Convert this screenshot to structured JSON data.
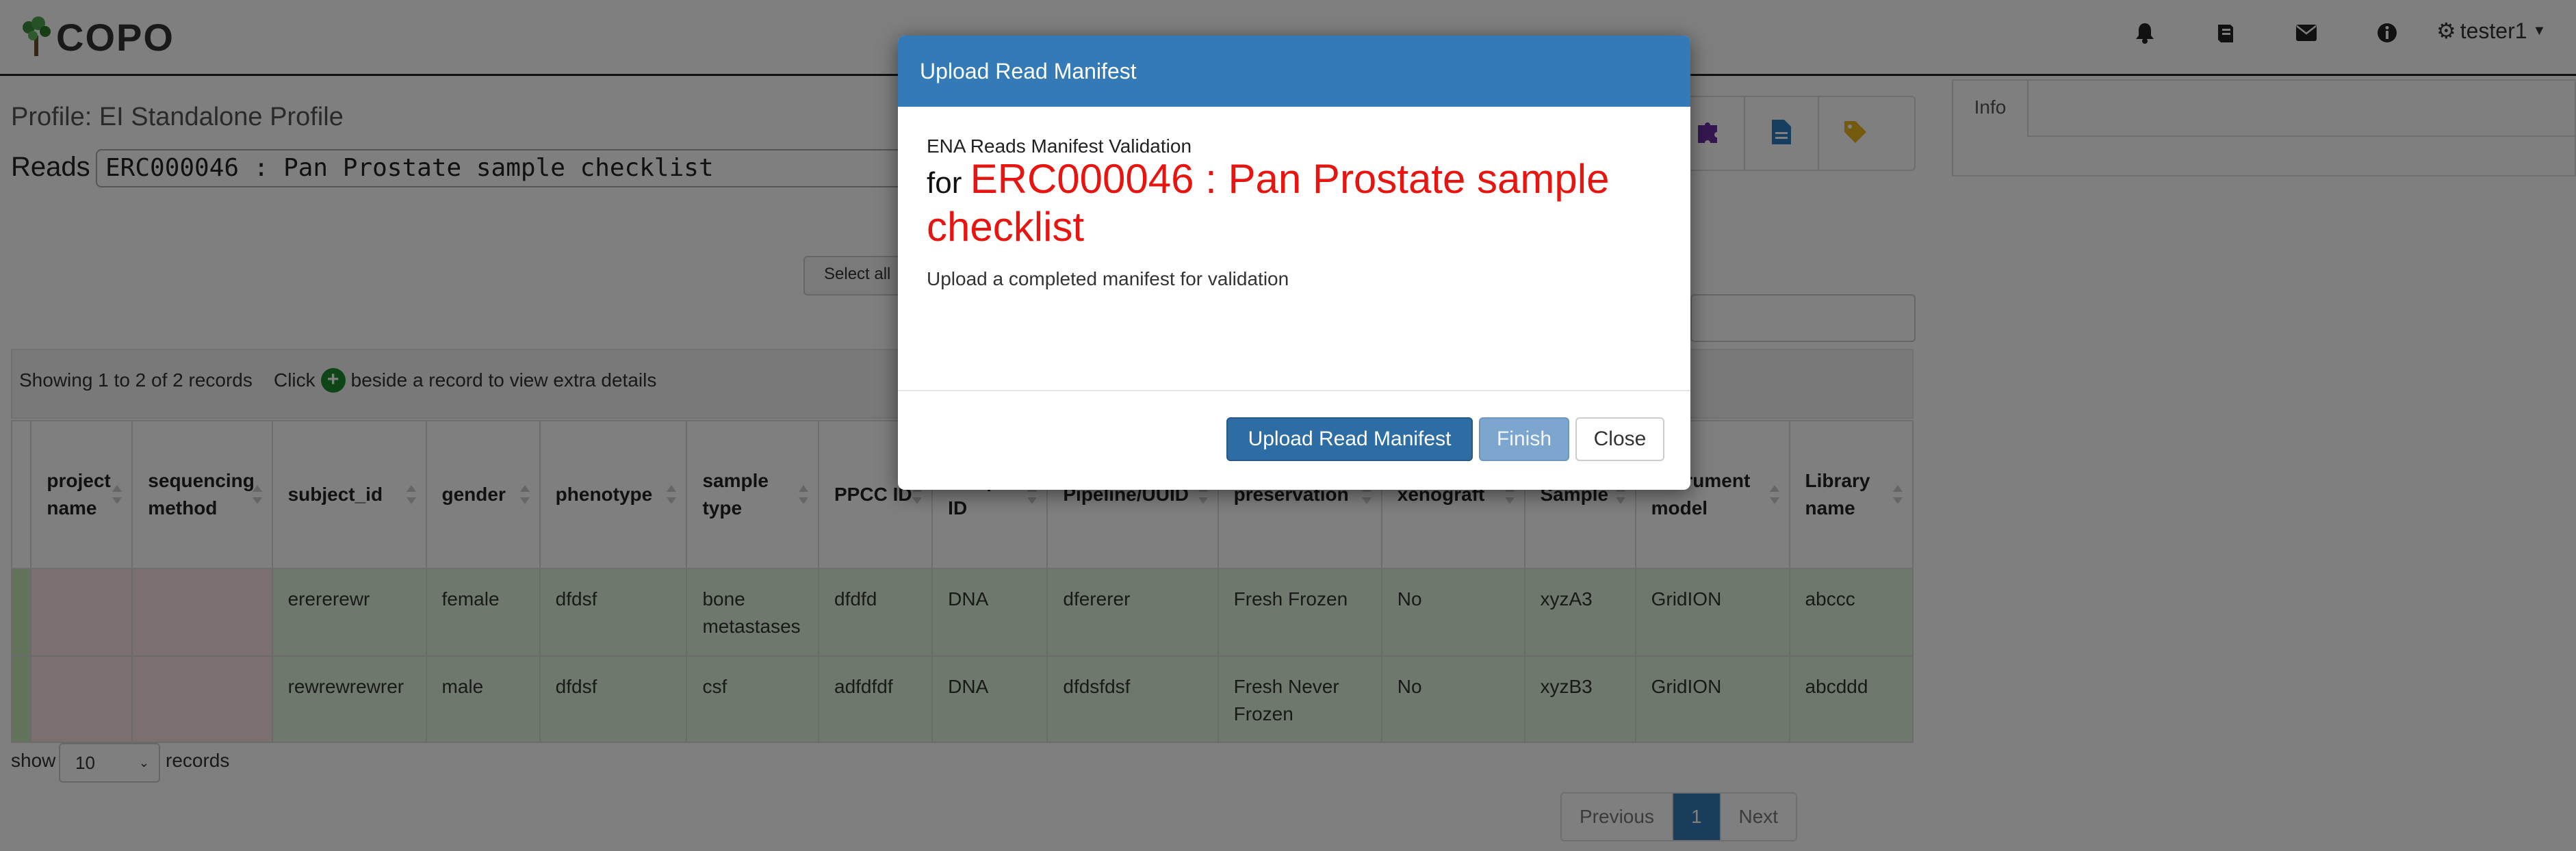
{
  "navbar": {
    "brand": "COPO",
    "icons": [
      "bell-icon",
      "book-icon",
      "envelope-icon",
      "info-icon"
    ],
    "user": "tester1"
  },
  "page": {
    "profile_title": "Profile: EI Standalone Profile",
    "reads_label": "Reads (",
    "checklist_selected": "ERC000046 : Pan Prostate sample checklist",
    "select_all": "Select all",
    "records_info_prefix": "Showing 1 to 2 of 2 records    Click",
    "records_info_suffix": "beside a record to view extra details",
    "show_label": "show",
    "page_size": "10",
    "records_label": "records",
    "info_tab": "Info"
  },
  "table": {
    "columns": [
      "project name",
      "sequencing method",
      "subject_id",
      "gender",
      "phenotype",
      "sample type",
      "PPCC ID",
      "sample ID",
      "Pipeline/UUID",
      "preservation",
      "xenograft",
      "Sample",
      "Instrument model",
      "Library name"
    ],
    "rows": [
      [
        "",
        "",
        "erererewr",
        "female",
        "dfdsf",
        "bone metastases",
        "dfdfd",
        "DNA",
        "dfererer",
        "Fresh Frozen",
        "No",
        "xyzA3",
        "GridION",
        "abccc"
      ],
      [
        "",
        "",
        "rewrewrewrer",
        "male",
        "dfdsf",
        "csf",
        "adfdfdf",
        "DNA",
        "dfdsfdsf",
        "Fresh Never Frozen",
        "No",
        "xyzB3",
        "GridION",
        "abcddd"
      ]
    ]
  },
  "pagination": {
    "previous": "Previous",
    "current": "1",
    "next": "Next"
  },
  "modal": {
    "title": "Upload Read Manifest",
    "validation_label": "ENA Reads Manifest Validation",
    "for_word": "for",
    "checklist_name": "ERC000046 : Pan Prostate sample checklist",
    "description": "Upload a completed manifest for validation",
    "buttons": {
      "upload": "Upload Read Manifest",
      "finish": "Finish",
      "close": "Close"
    }
  },
  "colors": {
    "modal_header": "#337ab7",
    "checklist_red": "#e8140f",
    "row_green": "#dff0d8",
    "row_pink": "#f9dede"
  }
}
